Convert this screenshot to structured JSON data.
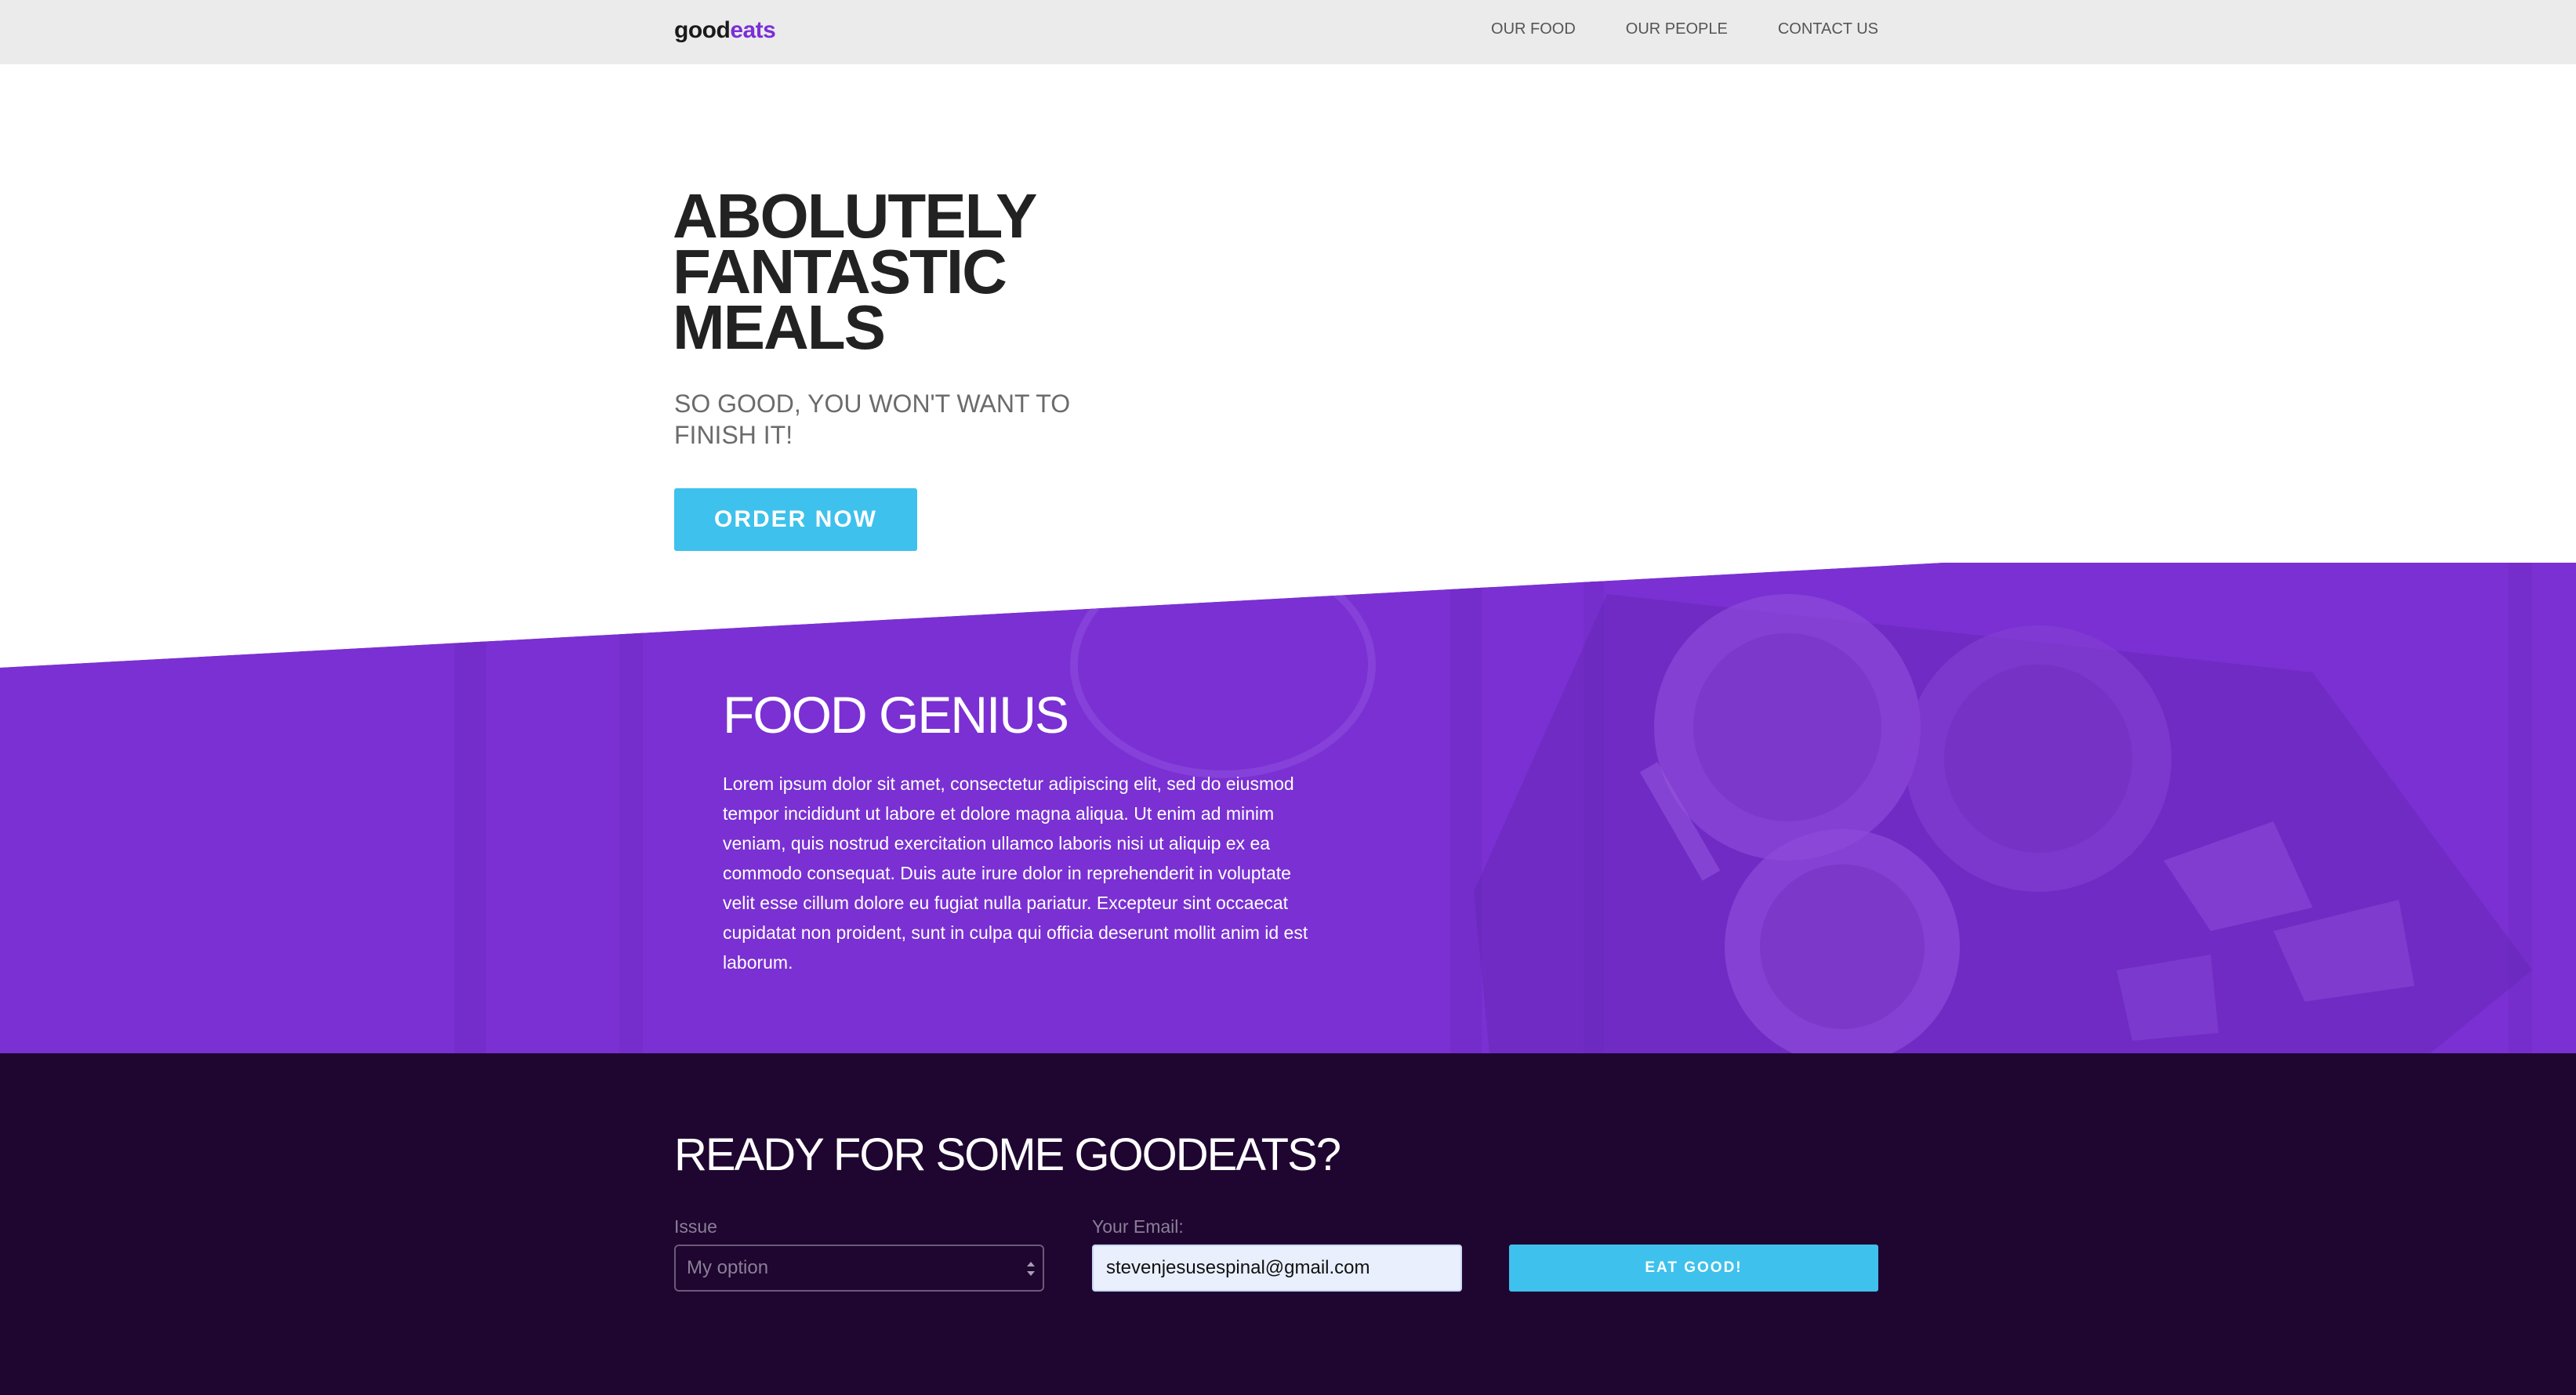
{
  "brand": {
    "logo_part1": "good",
    "logo_part2": "eats",
    "accent_color": "#7b2fd6",
    "button_color": "#3ec1ec"
  },
  "nav": {
    "items": [
      {
        "label": "OUR FOOD"
      },
      {
        "label": "OUR PEOPLE"
      },
      {
        "label": "CONTACT US"
      }
    ]
  },
  "hero": {
    "title_line1": "ABOLUTELY",
    "title_line2": "FANTASTIC",
    "title_line3": "MEALS",
    "subtitle": "SO GOOD, YOU WON'T WANT TO FINISH IT!",
    "button_label": "ORDER NOW"
  },
  "feature": {
    "background_color": "#7a30d2",
    "title": "FOOD GENIUS",
    "body": "Lorem ipsum dolor sit amet, consectetur adipiscing elit, sed do eiusmod tempor incididunt ut labore et dolore magna aliqua. Ut enim ad minim veniam, quis nostrud exercitation ullamco laboris nisi ut aliquip ex ea commodo consequat. Duis aute irure dolor in reprehenderit in voluptate velit esse cillum dolore eu fugiat nulla pariatur. Excepteur sint occaecat cupidatat non proident, sunt in culpa qui officia deserunt mollit anim id est laborum."
  },
  "cta": {
    "background_color": "#1f0630",
    "title": "READY FOR SOME GOODEATS?",
    "issue_label": "Issue",
    "issue_selected": "My option",
    "email_label": "Your Email:",
    "email_value": "stevenjesusespinal@gmail.com",
    "submit_label": "EAT GOOD!"
  }
}
